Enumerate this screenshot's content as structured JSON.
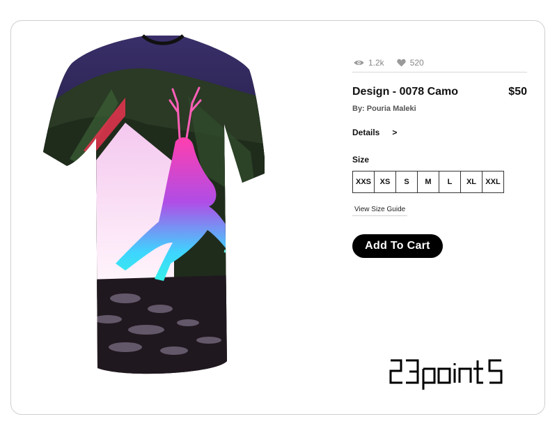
{
  "stats": {
    "views": "1.2k",
    "likes": "520"
  },
  "product": {
    "title": "Design - 0078 Camo",
    "price": "$50",
    "author": "By: Pouria Maleki"
  },
  "details": {
    "label": "Details",
    "arrow": ">"
  },
  "sizes": {
    "label": "Size",
    "options": [
      "XXS",
      "XS",
      "S",
      "M",
      "L",
      "XL",
      "XXL"
    ],
    "guide_label": "View Size Guide"
  },
  "cart": {
    "label": "Add To Cart"
  },
  "brand": {
    "logo_text": "23point5"
  },
  "colors": {
    "accent": "#000000",
    "muted": "#888888",
    "border": "#cfcfcf"
  }
}
